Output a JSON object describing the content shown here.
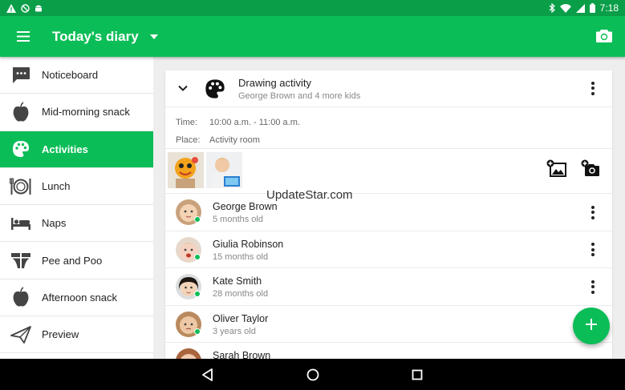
{
  "status_bar": {
    "time": "7:18",
    "left_icons": [
      "warning-icon",
      "do-not-disturb-icon",
      "android-icon"
    ],
    "right_icons": [
      "bluetooth-icon",
      "wifi-icon",
      "signal-icon",
      "battery-icon"
    ]
  },
  "app_bar": {
    "title": "Today's diary",
    "color": "#0bbd57",
    "menu_icon": "hamburger-menu-icon",
    "camera_icon": "camera-icon"
  },
  "sidebar": {
    "items": [
      {
        "label": "Noticeboard",
        "icon": "message-board-icon",
        "active": false
      },
      {
        "label": "Mid-morning snack",
        "icon": "apple-icon",
        "active": false
      },
      {
        "label": "Activities",
        "icon": "palette-icon",
        "active": true
      },
      {
        "label": "Lunch",
        "icon": "plate-cutlery-icon",
        "active": false
      },
      {
        "label": "Naps",
        "icon": "bed-icon",
        "active": false
      },
      {
        "label": "Pee and Poo",
        "icon": "diaper-icon",
        "active": false
      },
      {
        "label": "Afternoon snack",
        "icon": "apple-icon",
        "active": false
      },
      {
        "label": "Preview",
        "icon": "send-icon",
        "active": false
      }
    ]
  },
  "activity": {
    "title": "Drawing activity",
    "subtitle": "George Brown and 4 more kids",
    "time_label": "Time:",
    "time_value": "10:00 a.m. - 11:00 a.m.",
    "place_label": "Place:",
    "place_value": "Activity room",
    "children": [
      {
        "name": "George Brown",
        "age": "5 months old"
      },
      {
        "name": "Giulia Robinson",
        "age": "15 months old"
      },
      {
        "name": "Kate Smith",
        "age": "28 months old"
      },
      {
        "name": "Oliver Taylor",
        "age": "3 years old"
      },
      {
        "name": "Sarah Brown",
        "age": ""
      }
    ]
  },
  "watermark": "UpdateStar.com"
}
